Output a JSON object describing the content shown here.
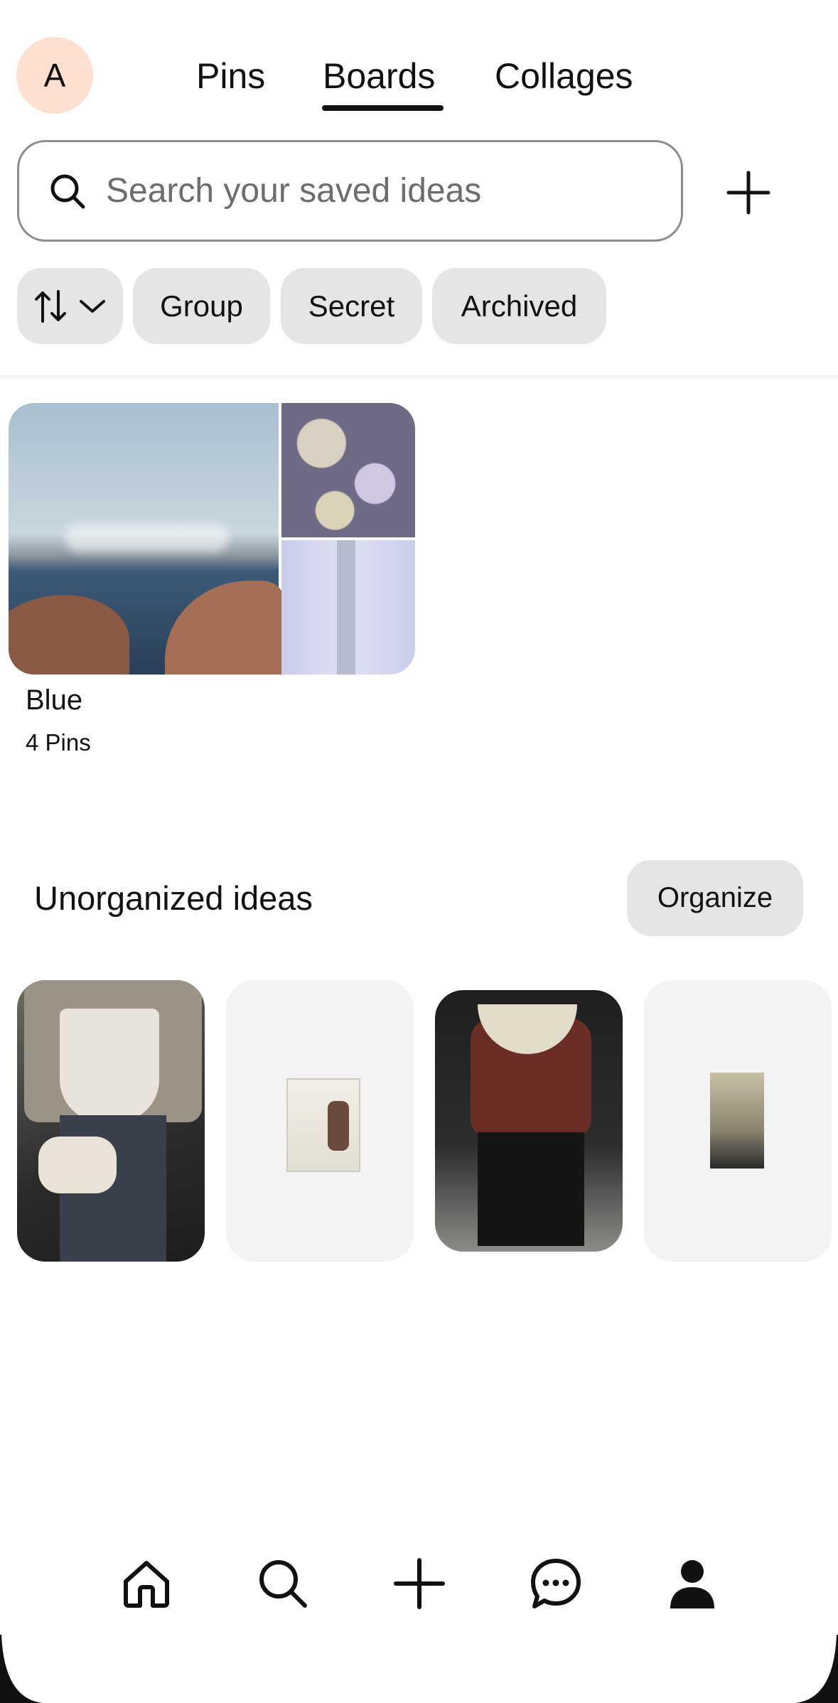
{
  "header": {
    "avatar_letter": "A",
    "tabs": [
      {
        "label": "Pins",
        "active": false
      },
      {
        "label": "Boards",
        "active": true
      },
      {
        "label": "Collages",
        "active": false
      }
    ]
  },
  "search": {
    "placeholder": "Search your saved ideas",
    "icon": "search-icon",
    "add_icon": "plus-icon"
  },
  "filters": {
    "sort_icon": "sort-arrows-icon",
    "chips": [
      "Group",
      "Secret",
      "Archived"
    ]
  },
  "boards": [
    {
      "title": "Blue",
      "count": "4 Pins"
    }
  ],
  "unorganized": {
    "title": "Unorganized ideas",
    "organize_label": "Organize"
  },
  "bottom_nav": {
    "items": [
      "home-icon",
      "search-icon",
      "create-plus-icon",
      "messages-icon",
      "profile-icon"
    ]
  },
  "colors": {
    "accent_avatar_bg": "#fde0cf",
    "chip_bg": "#e5e5e3",
    "text": "#111111"
  }
}
